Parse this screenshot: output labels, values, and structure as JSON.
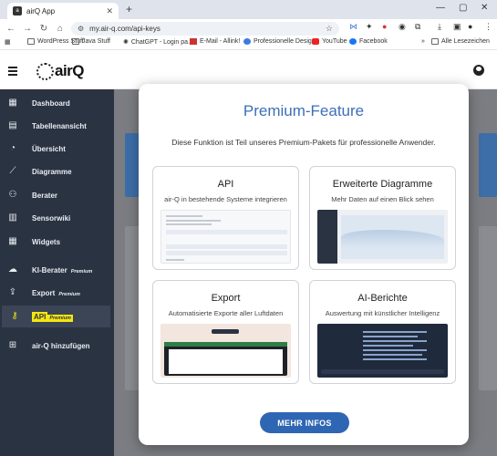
{
  "browser": {
    "tab_title": "airQ App",
    "url": "my.air-q.com/api-keys",
    "bookmarks": [
      "WordPress Stuff",
      "Java Stuff",
      "ChatGPT - Login pa...",
      "E-Mail - Allink!",
      "Professionelle Desig...",
      "YouTube",
      "Facebook",
      "Alle Lesezeichen"
    ]
  },
  "app": {
    "logo_text": "airQ"
  },
  "sidebar": {
    "items": [
      {
        "label": "Dashboard",
        "icon": "dashboard-icon"
      },
      {
        "label": "Tabellenansicht",
        "icon": "table-icon"
      },
      {
        "label": "Übersicht",
        "icon": "overview-icon"
      },
      {
        "label": "Diagramme",
        "icon": "chart-icon"
      },
      {
        "label": "Berater",
        "icon": "people-icon"
      },
      {
        "label": "Sensorwiki",
        "icon": "book-icon"
      },
      {
        "label": "Widgets",
        "icon": "widget-icon"
      },
      {
        "label": "KI-Berater",
        "premium": "Premium",
        "icon": "ai-icon"
      },
      {
        "label": "Export",
        "premium": "Premium",
        "icon": "export-icon"
      },
      {
        "label": "API",
        "premium": "Premium",
        "icon": "key-icon",
        "active": true
      },
      {
        "label": "air-Q hinzufügen",
        "icon": "add-icon"
      }
    ]
  },
  "modal": {
    "title": "Premium-Feature",
    "subtitle": "Diese Funktion ist Teil unseres Premium-Pakets für professionelle Anwender.",
    "cards": [
      {
        "title": "API",
        "desc": "air-Q in bestehende Systeme integrieren"
      },
      {
        "title": "Erweiterte Diagramme",
        "desc": "Mehr Daten auf einen Blick sehen"
      },
      {
        "title": "Export",
        "desc": "Automatisierte Exporte aller Luftdaten"
      },
      {
        "title": "AI-Berichte",
        "desc": "Auswertung mit künstlicher Intelligenz"
      }
    ],
    "button_label": "MEHR INFOS"
  },
  "colors": {
    "accent": "#2f66b3",
    "title_blue": "#3c6fb8",
    "sidebar_bg": "#2a3342",
    "premium_highlight": "#f5e611"
  }
}
